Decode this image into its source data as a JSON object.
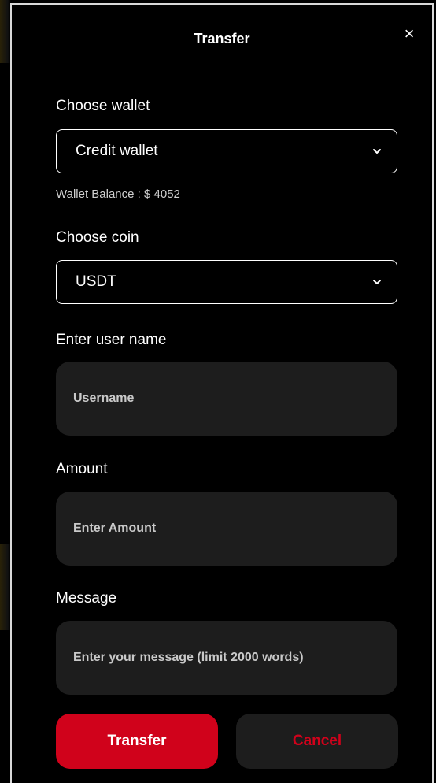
{
  "dialog": {
    "title": "Transfer",
    "close_glyph": "×"
  },
  "wallet": {
    "label": "Choose wallet",
    "selected": "Credit wallet",
    "balance_text": "Wallet Balance : $ 4052"
  },
  "coin": {
    "label": "Choose coin",
    "selected": "USDT"
  },
  "username": {
    "label": "Enter user name",
    "placeholder": "Username",
    "value": ""
  },
  "amount": {
    "label": "Amount",
    "placeholder": "Enter Amount",
    "value": ""
  },
  "message": {
    "label": "Message",
    "placeholder": "Enter your message (limit 2000 words)",
    "value": ""
  },
  "actions": {
    "transfer_label": "Transfer",
    "cancel_label": "Cancel"
  },
  "colors": {
    "accent": "#d0021b",
    "field_bg": "#1d1d1d",
    "modal_bg": "#000000",
    "border": "#ffffff"
  },
  "icons": {
    "close": "close-icon",
    "dropdown": "chevron-down-icon"
  }
}
